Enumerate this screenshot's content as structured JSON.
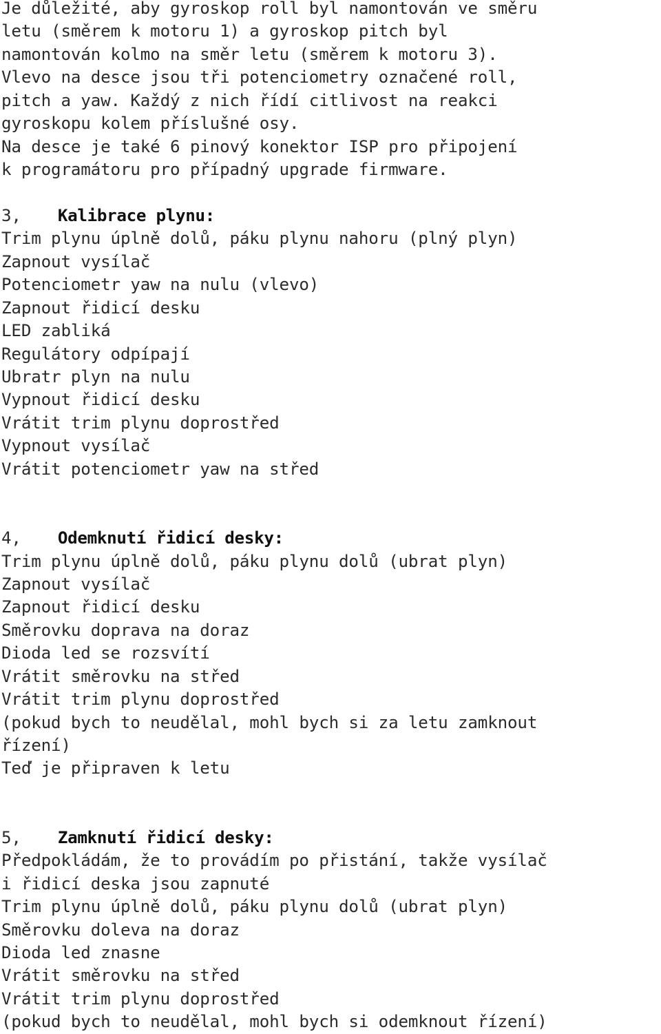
{
  "document": {
    "language": "cs",
    "text_color": "#2b2b2b",
    "heading_color": "#111111",
    "background_color": "#ffffff",
    "intro_paragraph": {
      "lines": [
        "Je důležité, aby gyroskop roll byl namontován ve směru",
        "letu (směrem k motoru 1) a gyroskop pitch byl",
        "namontován kolmo na směr letu (směrem k motoru 3).",
        "Vlevo na desce jsou tři potenciometry označené roll,",
        "pitch a yaw. Každý z nich řídí citlivost na reakci",
        "gyroskopu kolem příslušné osy.",
        "Na desce je také 6 pinový konektor ISP pro připojení",
        "k programátoru pro případný upgrade firmware."
      ]
    },
    "sections": [
      {
        "number": "3,",
        "title": "Kalibrace plynu:",
        "lines": [
          "Trim plynu úplně dolů, páku plynu nahoru (plný plyn)",
          "Zapnout vysílač",
          "Potenciometr yaw na nulu (vlevo)",
          "Zapnout řidicí desku",
          "LED zabliká",
          "Regulátory odpípají",
          "Ubratr plyn na nulu",
          "Vypnout řidicí desku",
          "Vrátit trim plynu doprostřed",
          "Vypnout vysílač",
          "Vrátit potenciometr yaw na střed"
        ]
      },
      {
        "number": "4,",
        "title": "Odemknutí řidicí desky:",
        "lines": [
          "Trim plynu úplně dolů, páku plynu dolů (ubrat plyn)",
          "Zapnout vysílač",
          "Zapnout řidicí desku",
          "Směrovku doprava na doraz",
          "Dioda led se rozsvítí",
          "Vrátit směrovku na střed",
          "Vrátit trim plynu doprostřed",
          "(pokud bych to neudělal, mohl bych si za letu zamknout",
          "řízení)",
          "Teď je připraven k letu"
        ]
      },
      {
        "number": "5,",
        "title": "Zamknutí řidicí desky:",
        "lines": [
          "Předpokládám, že to provádím po přistání, takže vysílač",
          "i řidicí deska jsou zapnuté",
          "Trim plynu úplně dolů, páku plynu dolů (ubrat plyn)",
          "Směrovku doleva na doraz",
          "Dioda led znasne",
          "Vrátit směrovku na střed",
          "Vrátit trim plynu doprostřed",
          "(pokud bych to neudělal, mohl bych si odemknout řízení)"
        ]
      }
    ]
  }
}
